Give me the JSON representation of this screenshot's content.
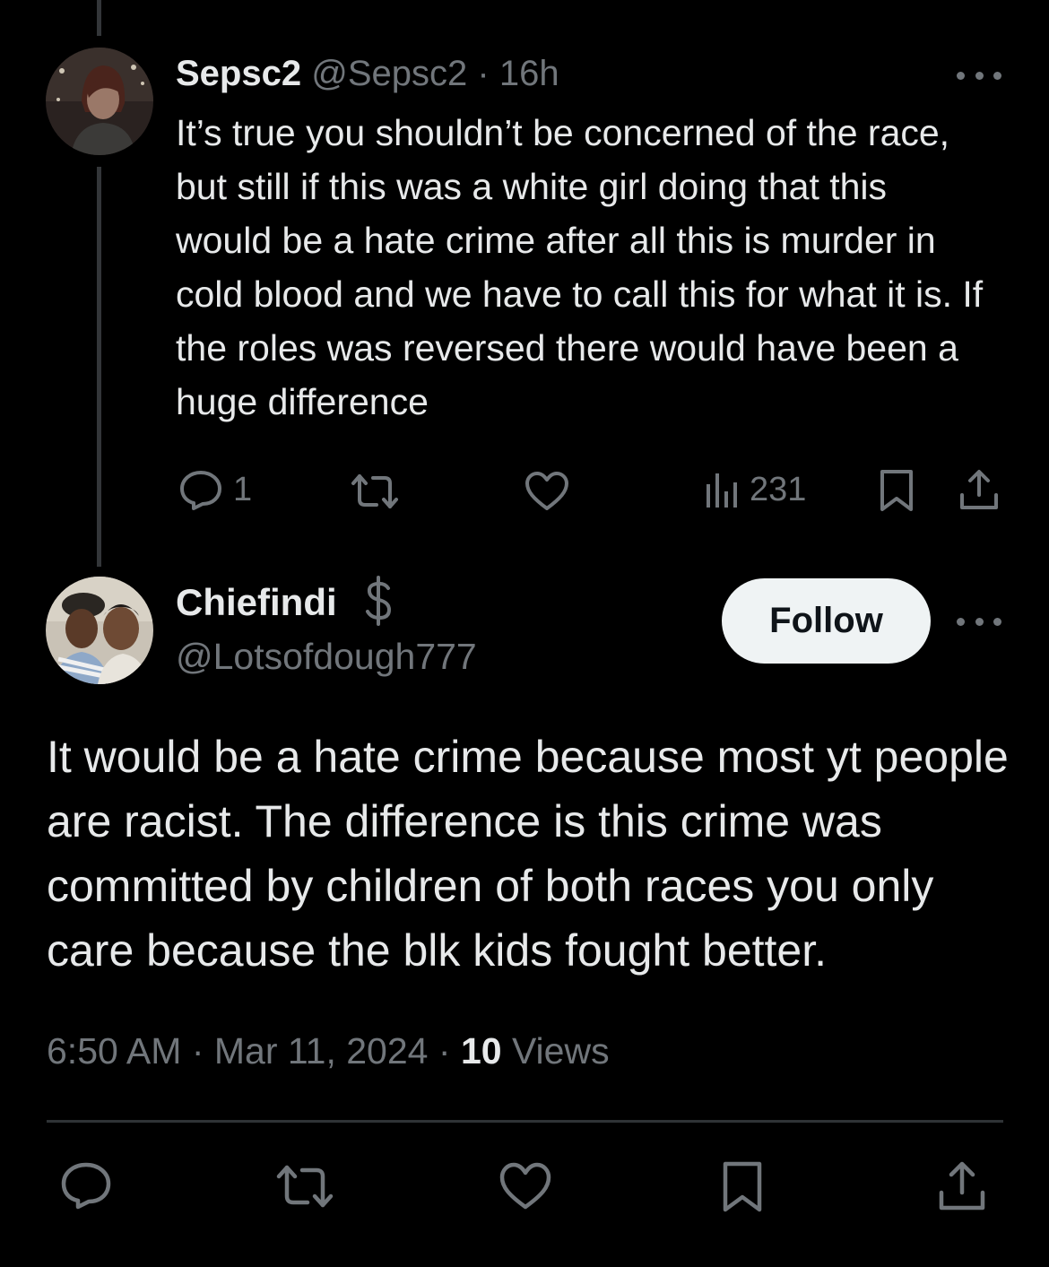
{
  "parent": {
    "display_name": "Sepsc2",
    "handle": "@Sepsc2",
    "separator": "·",
    "time": "16h",
    "text": "It’s true you shouldn’t be concerned of the race, but still if this was a white girl doing that this would be a hate crime after all this is murder in cold blood and we have to call this for what it is. If the roles was reversed there would have been a huge difference",
    "reply_count": "1",
    "views_count": "231",
    "icons": [
      "reply-icon",
      "retweet-icon",
      "like-icon",
      "views-icon",
      "bookmark-icon",
      "share-icon"
    ]
  },
  "reply": {
    "display_name": "Chiefindi",
    "badge_icon": "dollar-badge-icon",
    "handle": "@Lotsofdough777",
    "follow_label": "Follow",
    "text": "It would be a hate crime because most yt people are racist. The difference is this crime was committed by children of both races you only care because the blk kids fought better.",
    "time": "6:50 AM",
    "sep1": "·",
    "date": "Mar 11, 2024",
    "sep2": "·",
    "views_count": "10",
    "views_label": "Views",
    "icons": [
      "reply-icon",
      "retweet-icon",
      "like-icon",
      "bookmark-icon",
      "share-icon"
    ]
  },
  "colors": {
    "background": "#000000",
    "text": "#e7e9ea",
    "muted": "#71767b",
    "divider": "#2f3336",
    "follow_bg": "#eff3f4"
  }
}
